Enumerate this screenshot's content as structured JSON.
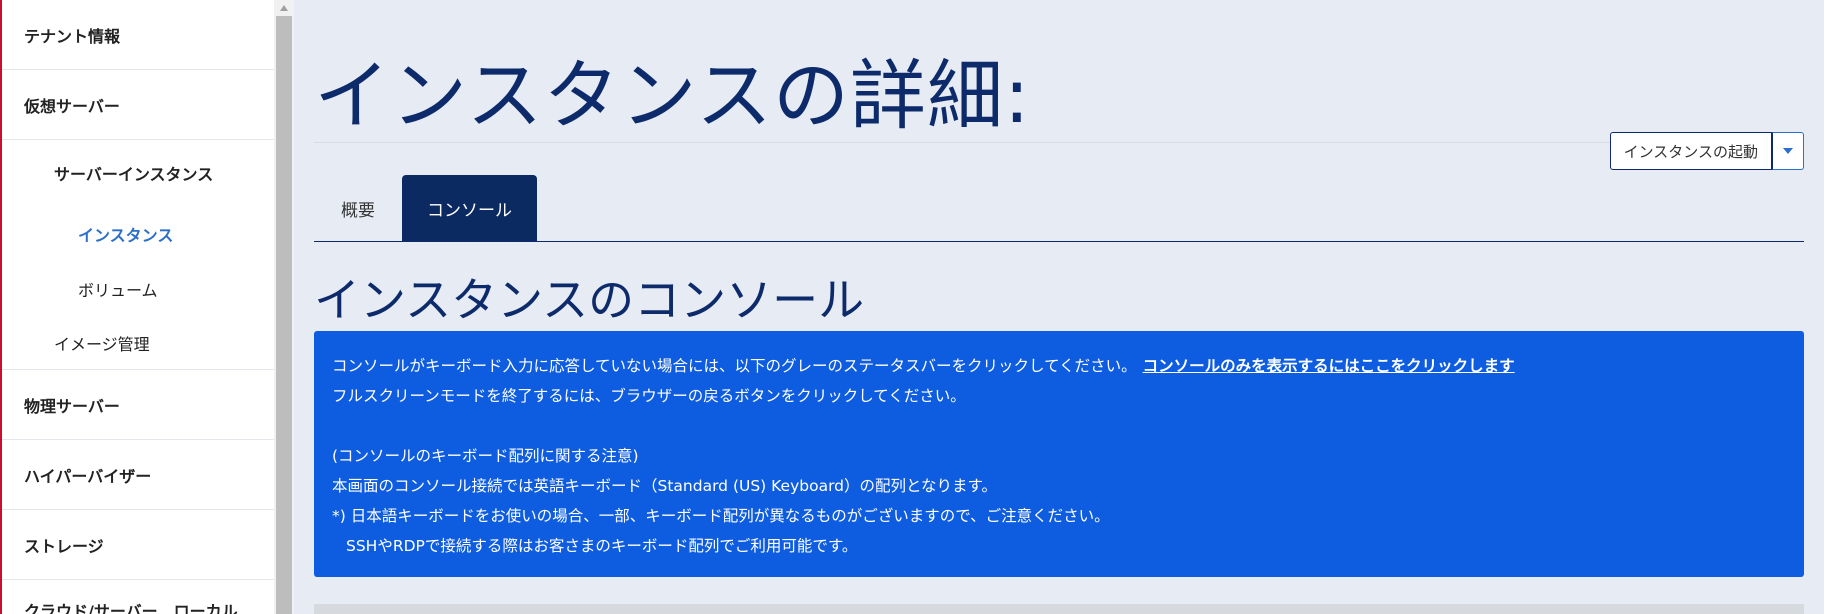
{
  "sidebar": {
    "items": [
      {
        "label": "テナント情報"
      },
      {
        "label": "仮想サーバー"
      },
      {
        "label": "サーバーインスタンス"
      },
      {
        "label": "インスタンス"
      },
      {
        "label": "ボリューム"
      },
      {
        "label": "イメージ管理"
      },
      {
        "label": "物理サーバー"
      },
      {
        "label": "ハイパーバイザー"
      },
      {
        "label": "ストレージ"
      },
      {
        "label": "クラウド/サーバー　ローカル"
      }
    ]
  },
  "header": {
    "title": "インスタンスの詳細:",
    "action_label": "インスタンスの起動"
  },
  "tabs": [
    {
      "label": "概要"
    },
    {
      "label": "コンソール"
    }
  ],
  "section": {
    "title": "インスタンスのコンソール"
  },
  "info": {
    "line1": "コンソールがキーボード入力に応答していない場合には、以下のグレーのステータスバーをクリックしてください。",
    "link": "コンソールのみを表示するにはここをクリックします",
    "line2": "フルスクリーンモードを終了するには、ブラウザーの戻るボタンをクリックしてください。",
    "line3": "(コンソールのキーボード配列に関する注意)",
    "line4": "本画面のコンソール接続では英語キーボード（Standard (US) Keyboard）の配列となります。",
    "line5": "*) 日本語キーボードをお使いの場合、一部、キーボード配列が異なるものがございますので、ご注意ください。",
    "line6": "SSHやRDPで接続する際はお客さまのキーボード配列でご利用可能です。"
  },
  "colors": {
    "brand": "#0d2b6b",
    "active_tab": "#0b2a62",
    "info_bg": "#0e5de0",
    "active_nav": "#2a6fc9"
  }
}
